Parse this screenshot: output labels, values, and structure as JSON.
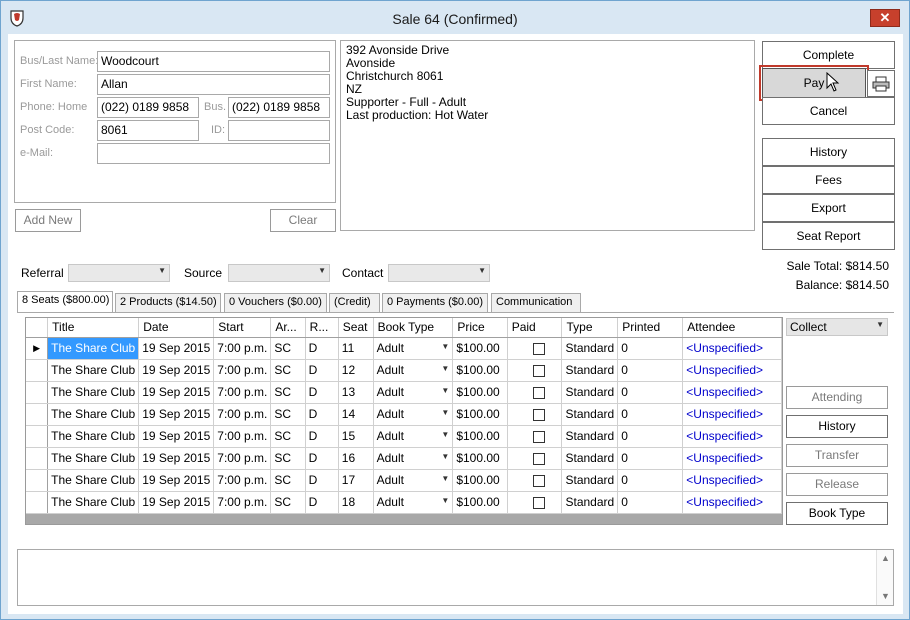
{
  "window": {
    "title": "Sale 64 (Confirmed)",
    "close_glyph": "✕"
  },
  "customer": {
    "bus_last_name_label": "Bus/Last Name:",
    "bus_last_name": "Woodcourt",
    "first_name_label": "First Name:",
    "first_name": "Allan",
    "phone_home_label": "Phone: Home",
    "phone_home": "(022) 0189 9858",
    "bus_label": "Bus.",
    "phone_bus": "(022) 0189 9858",
    "post_code_label": "Post Code:",
    "post_code": "8061",
    "id_label": "ID:",
    "id": "",
    "email_label": "e-Mail:",
    "email": "",
    "add_new_label": "Add New",
    "clear_label": "Clear"
  },
  "address": {
    "lines": [
      "392 Avonside Drive",
      "Avonside",
      "Christchurch 8061",
      "NZ",
      "Supporter - Full - Adult",
      "Last production: Hot Water"
    ]
  },
  "actions": {
    "complete": "Complete",
    "pay": "Pay",
    "cancel": "Cancel",
    "history": "History",
    "fees": "Fees",
    "export": "Export",
    "seat_report": "Seat Report",
    "printer_icon": "printer-icon"
  },
  "totals": {
    "sale_total_label": "Sale Total:",
    "sale_total": "$814.50",
    "balance_label": "Balance:",
    "balance": "$814.50"
  },
  "filters": {
    "referral_label": "Referral",
    "source_label": "Source",
    "contact_label": "Contact"
  },
  "tabs": [
    {
      "label": "8 Seats ($800.00)",
      "active": true
    },
    {
      "label": "2 Products ($14.50)",
      "active": false
    },
    {
      "label": "0 Vouchers ($0.00)",
      "active": false
    },
    {
      "label": "(Credit)",
      "active": false
    },
    {
      "label": "0 Payments ($0.00)",
      "active": false
    },
    {
      "label": "Communication",
      "active": false
    }
  ],
  "grid": {
    "columns": [
      "Title",
      "Date",
      "Start",
      "Ar...",
      "R...",
      "Seat",
      "Book Type",
      "Price",
      "Paid",
      "Type",
      "Printed",
      "Attendee"
    ],
    "rows": [
      {
        "title": "The Share Club",
        "date": "19 Sep 2015",
        "start": "7:00 p.m.",
        "area": "SC",
        "row": "D",
        "seat": "11",
        "book_type": "Adult",
        "price": "$100.00",
        "type": "Standard",
        "printed": "0",
        "attendee": "<Unspecified>"
      },
      {
        "title": "The Share Club",
        "date": "19 Sep 2015",
        "start": "7:00 p.m.",
        "area": "SC",
        "row": "D",
        "seat": "12",
        "book_type": "Adult",
        "price": "$100.00",
        "type": "Standard",
        "printed": "0",
        "attendee": "<Unspecified>"
      },
      {
        "title": "The Share Club",
        "date": "19 Sep 2015",
        "start": "7:00 p.m.",
        "area": "SC",
        "row": "D",
        "seat": "13",
        "book_type": "Adult",
        "price": "$100.00",
        "type": "Standard",
        "printed": "0",
        "attendee": "<Unspecified>"
      },
      {
        "title": "The Share Club",
        "date": "19 Sep 2015",
        "start": "7:00 p.m.",
        "area": "SC",
        "row": "D",
        "seat": "14",
        "book_type": "Adult",
        "price": "$100.00",
        "type": "Standard",
        "printed": "0",
        "attendee": "<Unspecified>"
      },
      {
        "title": "The Share Club",
        "date": "19 Sep 2015",
        "start": "7:00 p.m.",
        "area": "SC",
        "row": "D",
        "seat": "15",
        "book_type": "Adult",
        "price": "$100.00",
        "type": "Standard",
        "printed": "0",
        "attendee": "<Unspecified>"
      },
      {
        "title": "The Share Club",
        "date": "19 Sep 2015",
        "start": "7:00 p.m.",
        "area": "SC",
        "row": "D",
        "seat": "16",
        "book_type": "Adult",
        "price": "$100.00",
        "type": "Standard",
        "printed": "0",
        "attendee": "<Unspecified>"
      },
      {
        "title": "The Share Club",
        "date": "19 Sep 2015",
        "start": "7:00 p.m.",
        "area": "SC",
        "row": "D",
        "seat": "17",
        "book_type": "Adult",
        "price": "$100.00",
        "type": "Standard",
        "printed": "0",
        "attendee": "<Unspecified>"
      },
      {
        "title": "The Share Club",
        "date": "19 Sep 2015",
        "start": "7:00 p.m.",
        "area": "SC",
        "row": "D",
        "seat": "18",
        "book_type": "Adult",
        "price": "$100.00",
        "type": "Standard",
        "printed": "0",
        "attendee": "<Unspecified>"
      }
    ]
  },
  "seat_actions": {
    "collect": "Collect",
    "attending": "Attending",
    "history": "History",
    "transfer": "Transfer",
    "release": "Release",
    "book_type": "Book Type"
  },
  "colors": {
    "selection": "#3399ff",
    "pay_highlight": "#c0392b",
    "close": "#c7402c",
    "link": "#0000cc"
  }
}
